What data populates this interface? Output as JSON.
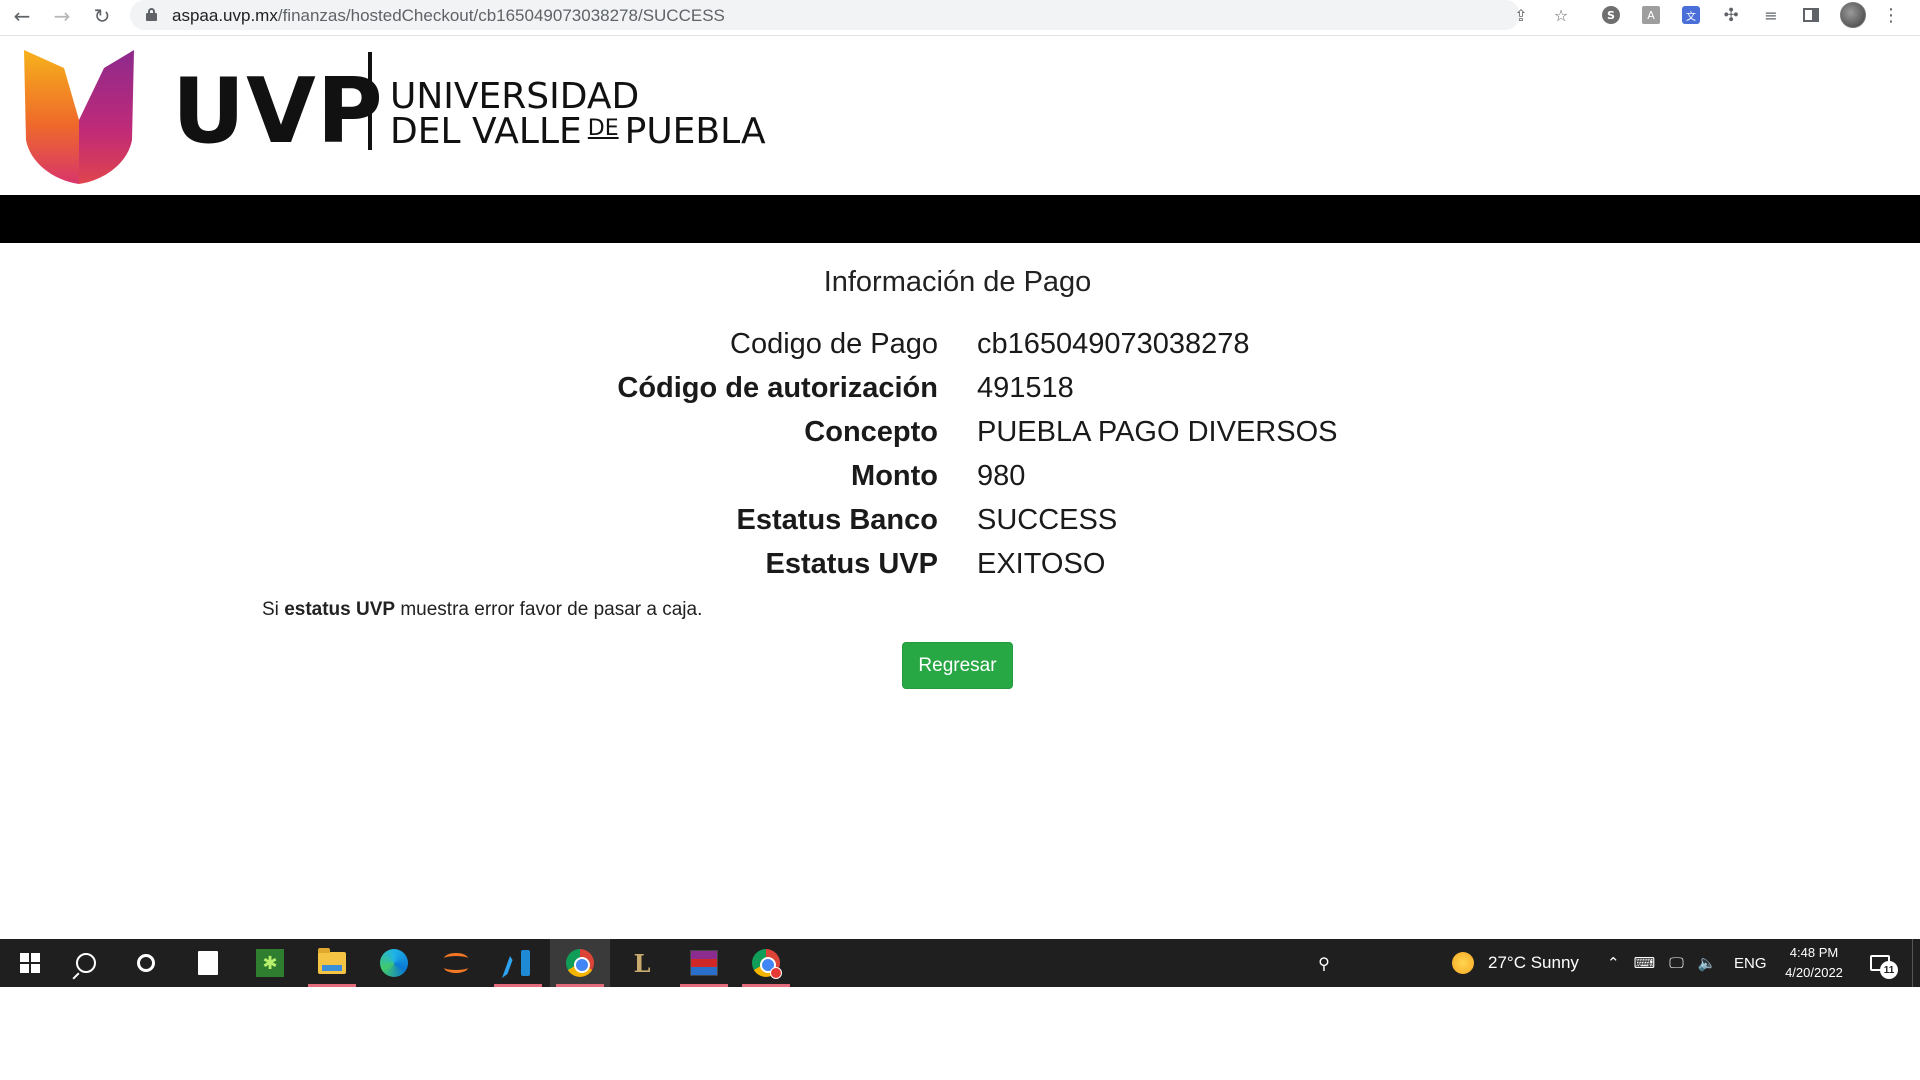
{
  "browser": {
    "url_host": "aspaa.uvp.mx",
    "url_path": "/finanzas/hostedCheckout/cb165049073038278/SUCCESS",
    "icons": [
      "back-icon",
      "forward-icon",
      "reload-icon",
      "lock-icon",
      "share-icon",
      "star-icon",
      "skype-extension-icon",
      "a-extension-icon",
      "translate-extension-icon",
      "puzzle-icon",
      "media-icon",
      "side-panel-icon",
      "avatar",
      "menu-icon"
    ]
  },
  "header": {
    "logo_abbrev": "UVP",
    "logo_line1": "UNIVERSIDAD",
    "logo_line2_a": "DEL VALLE",
    "logo_line2_de": "DE",
    "logo_line2_b": "PUEBLA"
  },
  "page": {
    "title": "Información de Pago",
    "rows": [
      {
        "label": "Codigo de Pago",
        "value": "cb165049073038278"
      },
      {
        "label": "Código de autorización",
        "value": "491518"
      },
      {
        "label": "Concepto",
        "value": "PUEBLA PAGO DIVERSOS"
      },
      {
        "label": "Monto",
        "value": "980"
      },
      {
        "label": "Estatus Banco",
        "value": "SUCCESS"
      },
      {
        "label": "Estatus UVP",
        "value": "EXITOSO"
      }
    ],
    "note_pre": "Si",
    "note_bold": "estatus UVP",
    "note_post": "muestra error favor de pasar a caja.",
    "button_label": "Regresar"
  },
  "taskbar": {
    "weather_text": "27°C  Sunny",
    "language": "ENG",
    "time": "4:48 PM",
    "date": "4/20/2022",
    "notification_count": "11"
  },
  "colors": {
    "button_green": "#28a745",
    "black_bar": "#000000",
    "taskbar_bg": "#1f1f1f"
  }
}
